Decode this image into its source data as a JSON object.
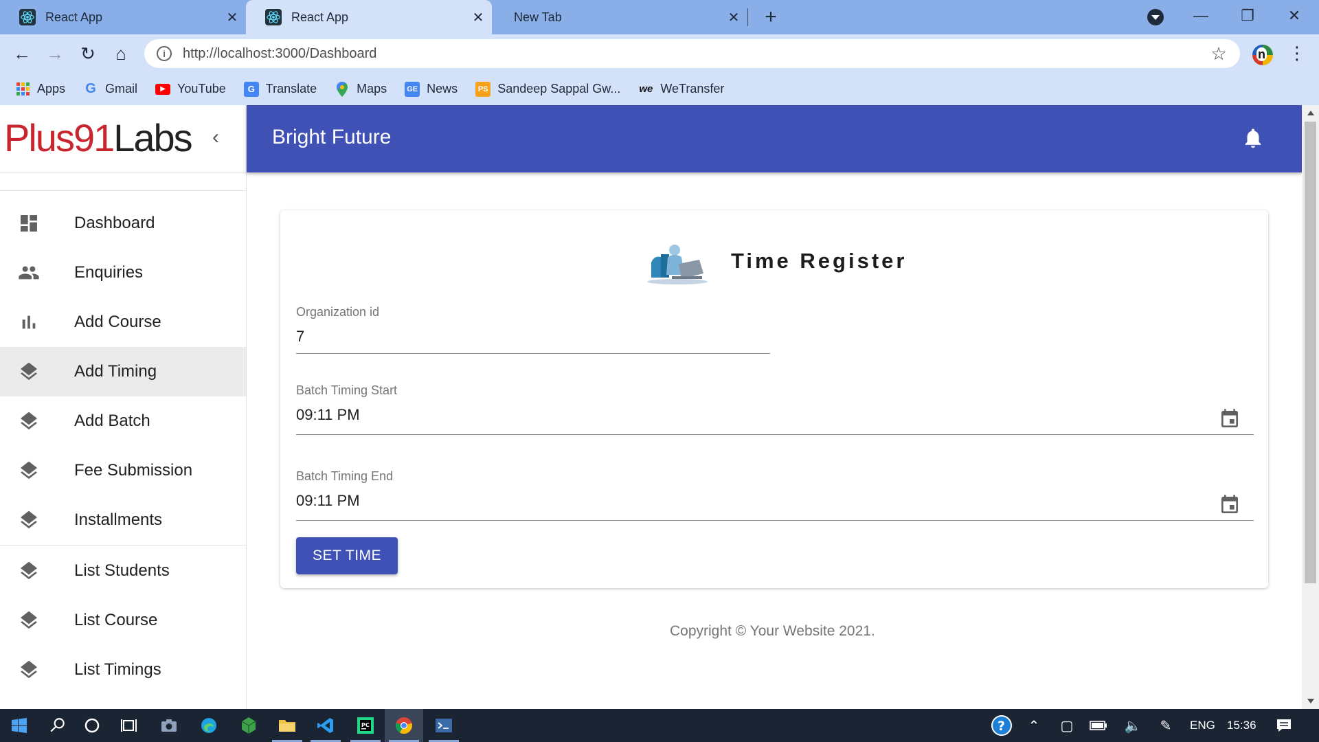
{
  "browser": {
    "tabs": [
      {
        "title": "React App",
        "active": false
      },
      {
        "title": "React App",
        "active": true
      },
      {
        "title": "New Tab",
        "active": false
      }
    ],
    "url": "http://localhost:3000/Dashboard",
    "bookmarks": [
      {
        "label": "Apps",
        "icon": "apps-grid-icon"
      },
      {
        "label": "Gmail",
        "icon": "google-icon"
      },
      {
        "label": "YouTube",
        "icon": "youtube-icon"
      },
      {
        "label": "Translate",
        "icon": "translate-icon"
      },
      {
        "label": "Maps",
        "icon": "maps-pin-icon"
      },
      {
        "label": "News",
        "icon": "news-icon"
      },
      {
        "label": "Sandeep Sappal Gw...",
        "icon": "ps-icon"
      },
      {
        "label": "WeTransfer",
        "icon": "wetransfer-icon"
      }
    ],
    "extension_label": "n"
  },
  "logo": {
    "part1": "Plus91",
    "part2": "Labs"
  },
  "appbar": {
    "title": "Bright Future"
  },
  "sidebar": {
    "items": [
      {
        "label": "Dashboard",
        "icon": "dashboard-icon"
      },
      {
        "label": "Enquiries",
        "icon": "people-icon"
      },
      {
        "label": "Add Course",
        "icon": "bar-chart-icon"
      },
      {
        "label": "Add Timing",
        "icon": "layers-icon",
        "selected": true
      },
      {
        "label": "Add Batch",
        "icon": "layers-icon"
      },
      {
        "label": "Fee Submission",
        "icon": "layers-icon"
      },
      {
        "label": "Installments",
        "icon": "layers-icon"
      },
      {
        "label": "List Students",
        "icon": "layers-icon"
      },
      {
        "label": "List Course",
        "icon": "layers-icon"
      },
      {
        "label": "List Timings",
        "icon": "layers-icon"
      }
    ]
  },
  "form": {
    "title": "Time Register",
    "org_label": "Organization id",
    "org_value": "7",
    "start_label": "Batch Timing Start",
    "start_value": "09:11 PM",
    "end_label": "Batch Timing End",
    "end_value": "09:11 PM",
    "submit_label": "SET TIME"
  },
  "footer": {
    "copyright": "Copyright © Your Website 2021."
  },
  "taskbar": {
    "lang": "ENG",
    "time": "15:36"
  },
  "colors": {
    "primary": "#3f51b5",
    "logo_red": "#c9252e",
    "tab_strip": "#8aaee8",
    "toolbar": "#d3e1f9",
    "taskbar": "#1a2433"
  }
}
